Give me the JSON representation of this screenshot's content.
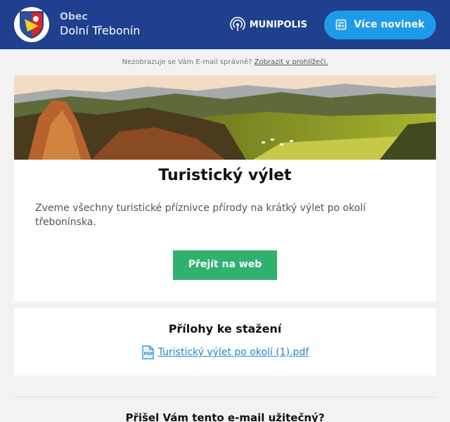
{
  "header": {
    "town_label": "Obec",
    "town_name": "Dolní Třebonín",
    "brand": "MUNIPOLIS",
    "more_news_label": "Více novinek"
  },
  "notice": {
    "text": "Nezobrazuje se Vám E-mail správně?",
    "link": "Zobrazit v prohlížeči."
  },
  "article": {
    "title": "Turistický výlet",
    "body": "Zveme všechny turistické příznivce přírody na krátký výlet po okolí třebonínska.",
    "cta_label": "Přejít na web"
  },
  "attachments": {
    "title": "Přílohy ke stažení",
    "files": [
      {
        "name": "Turistický výlet po okolí (1).pdf",
        "icon": "pdf-icon"
      }
    ]
  },
  "feedback": {
    "question": "Přišel Vám tento e-mail užitečný?"
  }
}
